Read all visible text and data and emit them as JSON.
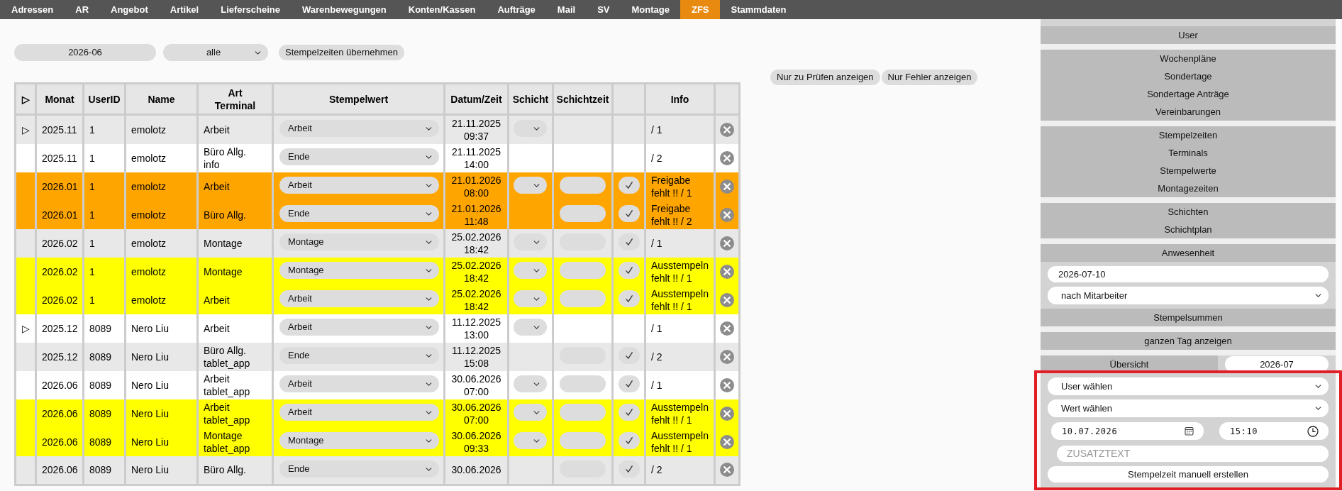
{
  "nav": [
    {
      "label": "Adressen",
      "selected": false
    },
    {
      "label": "AR",
      "selected": false
    },
    {
      "label": "Angebot",
      "selected": false
    },
    {
      "label": "Artikel",
      "selected": false
    },
    {
      "label": "Lieferscheine",
      "selected": false
    },
    {
      "label": "Warenbewegungen",
      "selected": false
    },
    {
      "label": "Konten/Kassen",
      "selected": false
    },
    {
      "label": "Aufträge",
      "selected": false
    },
    {
      "label": "Mail",
      "selected": false
    },
    {
      "label": "SV",
      "selected": false
    },
    {
      "label": "Montage",
      "selected": false
    },
    {
      "label": "ZFS",
      "selected": true
    },
    {
      "label": "Stammdaten",
      "selected": false
    }
  ],
  "toolbar": {
    "month": "2026-06",
    "filter": "alle",
    "apply_button": "Stempelzeiten übernehmen"
  },
  "filter_buttons": [
    "Nur zu Prüfen anzeigen",
    "Nur Fehler anzeigen"
  ],
  "table": {
    "columns": [
      {
        "kind": "text",
        "label": "▷"
      },
      {
        "kind": "text",
        "label": "Monat"
      },
      {
        "kind": "text",
        "label": "UserID"
      },
      {
        "kind": "text",
        "label": "Name"
      },
      {
        "kind": "text",
        "label": "Art\nTerminal"
      },
      {
        "kind": "text",
        "label": "Stempelwert"
      },
      {
        "kind": "text",
        "label": "Datum/Zeit"
      },
      {
        "kind": "text",
        "label": "Schicht"
      },
      {
        "kind": "text",
        "label": "Schichtzeit"
      },
      {
        "kind": "blank"
      },
      {
        "kind": "text",
        "label": "Info"
      },
      {
        "kind": "blank"
      }
    ],
    "rows": [
      {
        "marker": "▷",
        "month": "2025.11",
        "user_id": "1",
        "name": "emolotz",
        "art": "Arbeit",
        "stamp_value": "Arbeit",
        "date": "21.11.2025",
        "time": "09:37",
        "shift_select": true,
        "shift_time_field": false,
        "confirm": false,
        "info": "/ 1"
      },
      {
        "month": "2025.11",
        "user_id": "1",
        "name": "emolotz",
        "art": "Büro Allg.",
        "terminal": "info",
        "stamp_value": "Ende",
        "date": "21.11.2025",
        "time": "14:00",
        "shift_select": false,
        "shift_time_field": false,
        "confirm": false,
        "info": "/ 2"
      },
      {
        "month": "2026.01",
        "user_id": "1",
        "name": "emolotz",
        "art": "Arbeit",
        "stamp_value": "Arbeit",
        "date": "21.01.2026",
        "time": "08:00",
        "shift_select": true,
        "shift_time_field": true,
        "confirm": true,
        "info": "Freigabe fehlt !! / 1",
        "color": "#ffa500"
      },
      {
        "month": "2026.01",
        "user_id": "1",
        "name": "emolotz",
        "art": "Büro Allg.",
        "stamp_value": "Ende",
        "date": "21.01.2026",
        "time": "11:48",
        "shift_select": false,
        "shift_time_field": true,
        "confirm": true,
        "info": "Freigabe fehlt !! / 2",
        "color": "#ffa500"
      },
      {
        "month": "2026.02",
        "user_id": "1",
        "name": "emolotz",
        "art": "Montage",
        "stamp_value": "Montage",
        "date": "25.02.2026",
        "time": "18:42",
        "shift_select": true,
        "shift_time_field": true,
        "confirm": true,
        "info": "/ 1"
      },
      {
        "month": "2026.02",
        "user_id": "1",
        "name": "emolotz",
        "art": "Montage",
        "stamp_value": "Montage",
        "date": "25.02.2026",
        "time": "18:42",
        "shift_select": true,
        "shift_time_field": true,
        "confirm": true,
        "info": "Ausstempeln fehlt !! / 1",
        "color": "#ffff00"
      },
      {
        "month": "2026.02",
        "user_id": "1",
        "name": "emolotz",
        "art": "Arbeit",
        "stamp_value": "Arbeit",
        "date": "25.02.2026",
        "time": "18:42",
        "shift_select": true,
        "shift_time_field": true,
        "confirm": true,
        "info": "Ausstempeln fehlt !! / 1",
        "color": "#ffff00"
      },
      {
        "marker": "▷",
        "month": "2025.12",
        "user_id": "8089",
        "name": "Nero Liu",
        "art": "Arbeit",
        "stamp_value": "Arbeit",
        "date": "11.12.2025",
        "time": "13:00",
        "shift_select": true,
        "shift_time_field": false,
        "confirm": false,
        "info": "/ 1"
      },
      {
        "month": "2025.12",
        "user_id": "8089",
        "name": "Nero Liu",
        "art": "Büro Allg.",
        "terminal": "tablet_app",
        "stamp_value": "Ende",
        "date": "11.12.2025",
        "time": "15:08",
        "shift_select": false,
        "shift_time_field": true,
        "confirm": true,
        "info": "/ 2"
      },
      {
        "month": "2026.06",
        "user_id": "8089",
        "name": "Nero Liu",
        "art": "Arbeit",
        "terminal": "tablet_app",
        "stamp_value": "Arbeit",
        "date": "30.06.2026",
        "time": "07:00",
        "shift_select": true,
        "shift_time_field": true,
        "confirm": true,
        "info": "/ 1"
      },
      {
        "month": "2026.06",
        "user_id": "8089",
        "name": "Nero Liu",
        "art": "Arbeit",
        "terminal": "tablet_app",
        "stamp_value": "Arbeit",
        "date": "30.06.2026",
        "time": "07:00",
        "shift_select": true,
        "shift_time_field": true,
        "confirm": true,
        "info": "Ausstempeln fehlt !! / 1",
        "color": "#ffff00"
      },
      {
        "month": "2026.06",
        "user_id": "8089",
        "name": "Nero Liu",
        "art": "Montage",
        "terminal": "tablet_app",
        "stamp_value": "Montage",
        "date": "30.06.2026",
        "time": "09:33",
        "shift_select": true,
        "shift_time_field": true,
        "confirm": true,
        "info": "Ausstempeln fehlt !! / 1",
        "color": "#ffff00"
      },
      {
        "month": "2026.06",
        "user_id": "8089",
        "name": "Nero Liu",
        "art": "Büro Allg.",
        "stamp_value": "Ende",
        "date": "30.06.2026",
        "shift_select": false,
        "shift_time_field": true,
        "confirm": true,
        "info": "/ 2"
      }
    ]
  },
  "sidebar": {
    "menu_groups": [
      {
        "items": [
          "User"
        ]
      },
      {
        "items": [
          "Wochenpläne",
          "Sondertage",
          "Sondertage Anträge",
          "Vereinbarungen"
        ]
      },
      {
        "items": [
          "Stempelzeiten",
          "Terminals",
          "Stempelwerte",
          "Montagezeiten"
        ]
      },
      {
        "items": [
          "Schichten",
          "Schichtplan"
        ]
      }
    ],
    "presence": {
      "title": "Anwesenheit",
      "date": "2026-07-10",
      "view": "nach Mitarbeiter",
      "summary_link": "Stempelsummen"
    },
    "day_link": "ganzen Tag anzeigen",
    "overview": {
      "label": "Übersicht",
      "month": "2026-07"
    },
    "manual_entry": {
      "highlighted": true,
      "user": "User wählen",
      "value": "Wert wählen",
      "date": "10.07.2026",
      "time": "15:10",
      "note_placeholder": "ZUSATZTEXT",
      "submit": "Stempelzeit manuell erstellen"
    }
  }
}
